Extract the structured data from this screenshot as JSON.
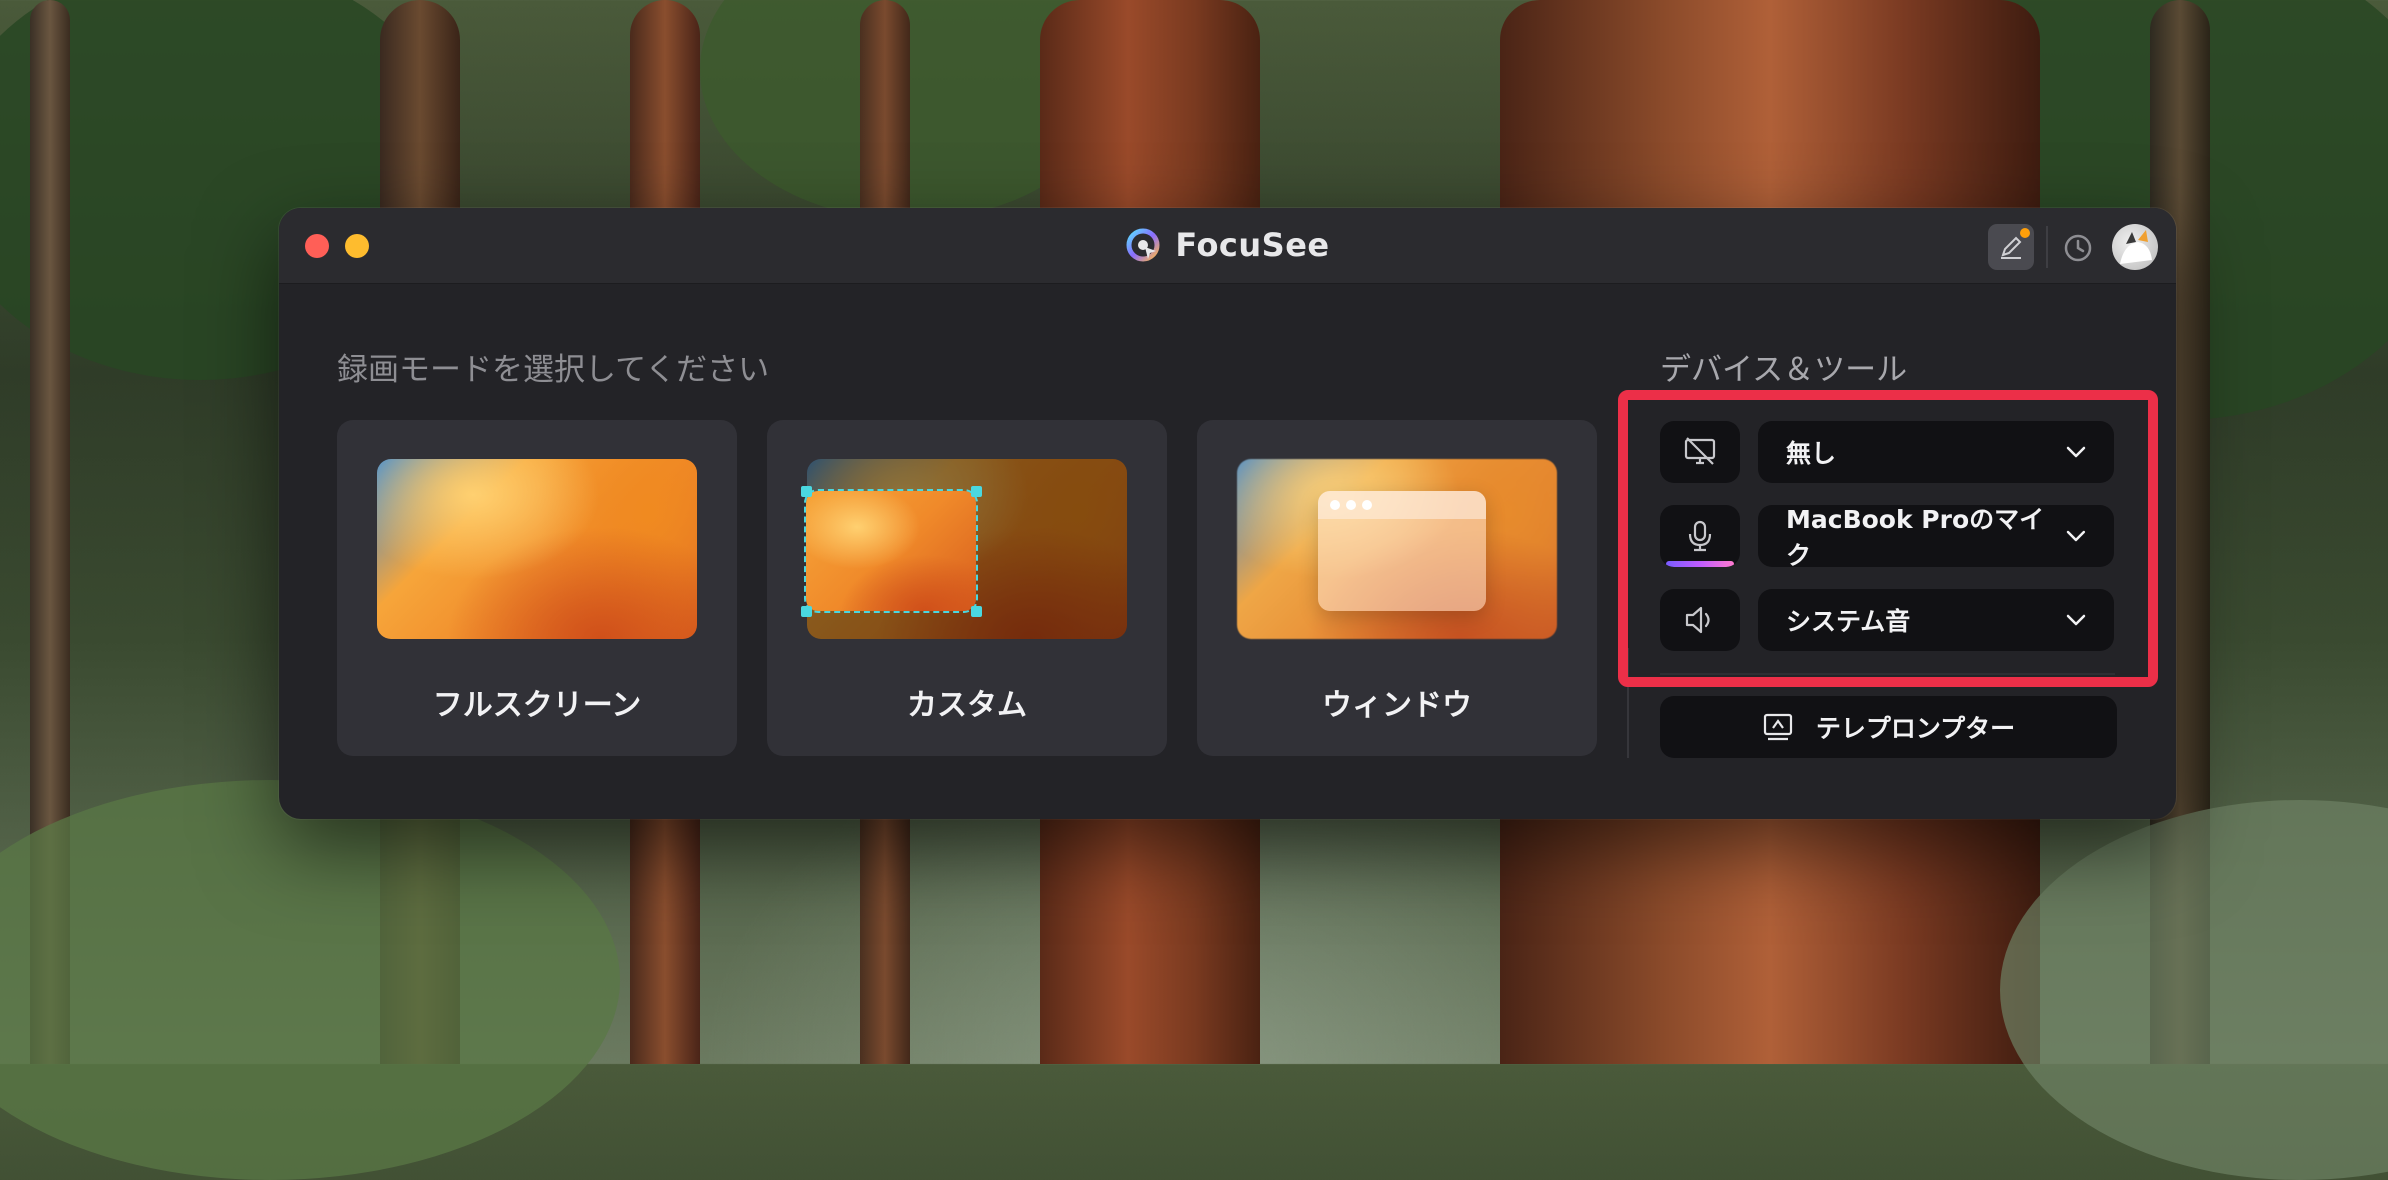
{
  "app": {
    "title": "FocuSee"
  },
  "left_panel": {
    "heading": "録画モードを選択してください",
    "modes": [
      {
        "label": "フルスクリーン"
      },
      {
        "label": "カスタム"
      },
      {
        "label": "ウィンドウ"
      }
    ]
  },
  "right_panel": {
    "heading": "デバイス＆ツール",
    "devices": [
      {
        "icon": "camera-off-icon",
        "value": "無し"
      },
      {
        "icon": "microphone-icon",
        "value": "MacBook Proのマイク"
      },
      {
        "icon": "speaker-icon",
        "value": "システム音"
      }
    ],
    "teleprompter_label": "テレプロンプター"
  },
  "colors": {
    "highlight": "#ec2f48",
    "accent_cyan": "#4ad8e0",
    "window_bg": "#232327",
    "card_bg": "#313137"
  }
}
